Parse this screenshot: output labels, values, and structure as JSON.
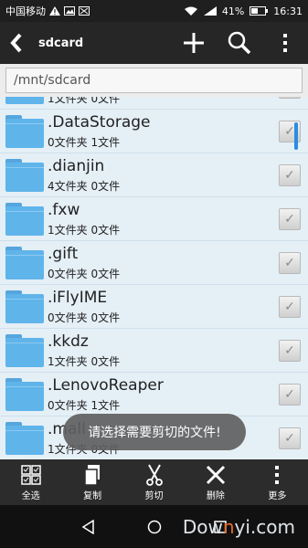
{
  "status_bar": {
    "carrier": "中国移动",
    "battery": "41%",
    "time": "16:31"
  },
  "toolbar": {
    "title": "sdcard"
  },
  "path": {
    "value": "/mnt/sdcard"
  },
  "list": {
    "partial_top_meta": "1文件夹  0文件",
    "items": [
      {
        "name": ".DataStorage",
        "meta": "0文件夹  1文件"
      },
      {
        "name": ".dianjin",
        "meta": "4文件夹  0文件"
      },
      {
        "name": ".fxw",
        "meta": "1文件夹  0文件"
      },
      {
        "name": ".gift",
        "meta": "0文件夹  0文件"
      },
      {
        "name": ".iFlyIME",
        "meta": "0文件夹  0文件"
      },
      {
        "name": ".kkdz",
        "meta": "1文件夹  0文件"
      },
      {
        "name": ".LenovoReaper",
        "meta": "0文件夹  1文件"
      },
      {
        "name": ".mall",
        "meta": "1文件夹  0文件"
      }
    ]
  },
  "toast": {
    "text": "请选择需要剪切的文件!"
  },
  "actions": [
    {
      "label": "全选",
      "icon": "select-all-icon"
    },
    {
      "label": "复制",
      "icon": "copy-icon"
    },
    {
      "label": "剪切",
      "icon": "scissors-icon"
    },
    {
      "label": "删除",
      "icon": "delete-x-icon"
    },
    {
      "label": "更多",
      "icon": "more-vertical-icon"
    }
  ],
  "watermark": {
    "text_a": "Dow",
    "text_b": "n",
    "text_c": "yi.com"
  }
}
